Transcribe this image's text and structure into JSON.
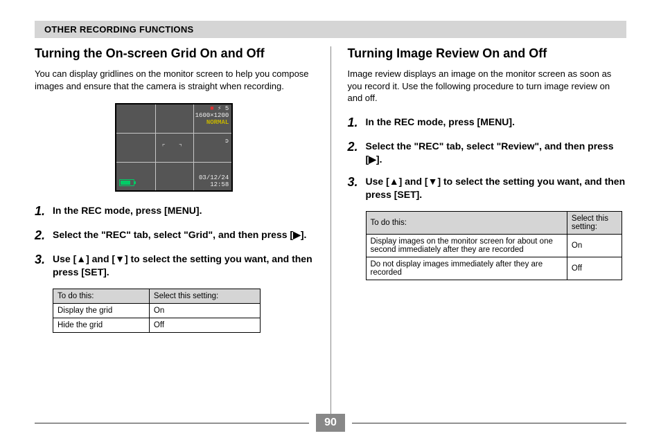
{
  "header": {
    "title": "OTHER RECORDING FUNCTIONS"
  },
  "left": {
    "heading": "Turning the On-screen Grid On and Off",
    "intro": "You can display gridlines on the monitor screen to help you compose images and ensure that the camera is straight when recording.",
    "camera": {
      "count": "5",
      "resolution": "1600×1200",
      "quality": "NORMAL",
      "date": "03/12/24",
      "time": "12:58"
    },
    "steps": {
      "1": "In the REC mode, press [MENU].",
      "2": "Select the \"REC\" tab, select \"Grid\", and then press [▶].",
      "3": "Use [▲] and [▼] to select the setting you want, and then press [SET]."
    },
    "table": {
      "h1": "To do this:",
      "h2": "Select this setting:",
      "r1c1": "Display the grid",
      "r1c2": "On",
      "r2c1": "Hide the grid",
      "r2c2": "Off"
    }
  },
  "right": {
    "heading": "Turning Image Review On and Off",
    "intro": "Image review displays an image on the monitor screen as soon as you record it. Use the following procedure to turn image review on and off.",
    "steps": {
      "1": "In the REC mode, press [MENU].",
      "2": "Select the \"REC\" tab, select \"Review\", and then press [▶].",
      "3": "Use [▲] and [▼] to select the setting you want, and then press [SET]."
    },
    "table": {
      "h1": "To do this:",
      "h2": "Select this setting:",
      "r1c1": "Display images on the monitor screen for about one second immediately after they are recorded",
      "r1c2": "On",
      "r2c1": "Do not display images immediately after they are recorded",
      "r2c2": "Off"
    }
  },
  "page_number": "90"
}
